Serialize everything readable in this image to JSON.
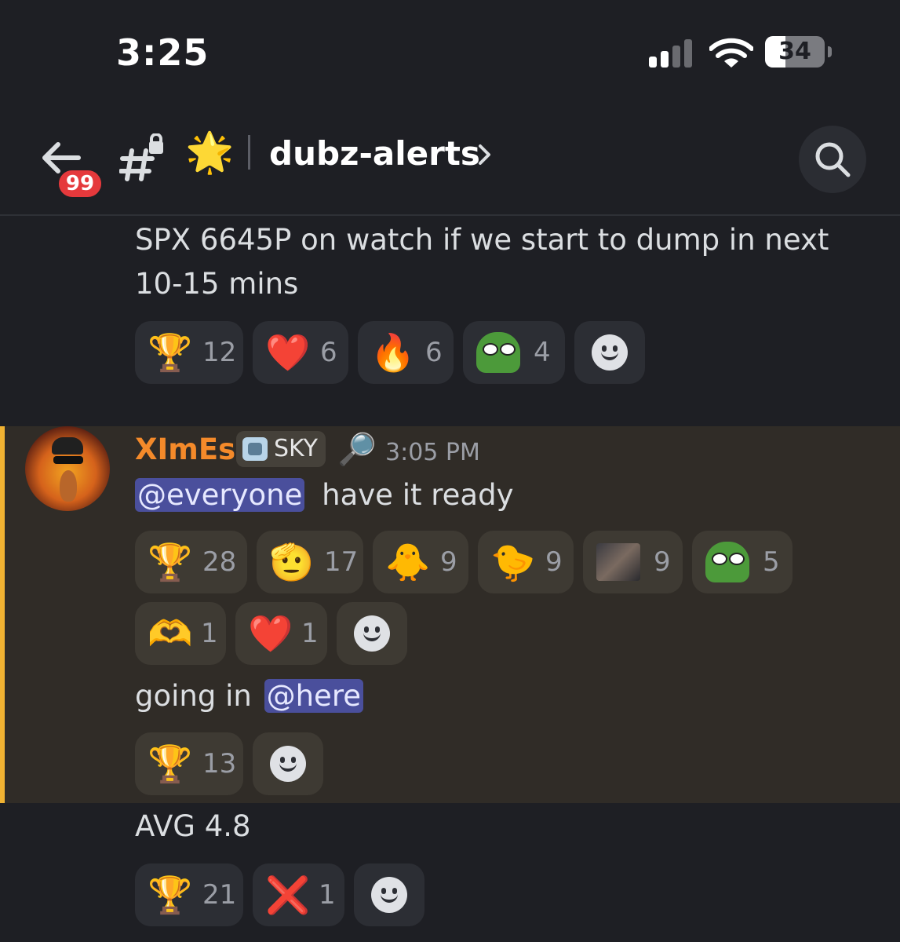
{
  "status_bar": {
    "time": "3:25",
    "battery": "34",
    "battery_level": 0.34
  },
  "header": {
    "notification_count": "99",
    "channel_emoji": "🌟",
    "channel_name": "dubz-alerts"
  },
  "messages": [
    {
      "text": "SPX 6645P on watch if we start to dump in next 10-15 mins",
      "reactions": [
        {
          "emoji": "🏆",
          "count": "12"
        },
        {
          "emoji": "❤️",
          "count": "6"
        },
        {
          "emoji": "🔥",
          "count": "6"
        },
        {
          "emoji": "pepe-sunglasses",
          "count": "4"
        }
      ]
    },
    {
      "author": "XImEs",
      "role": "SKY",
      "role_emoji": "🔎",
      "timestamp": "3:05 PM",
      "mention": "@everyone",
      "text_rest": "have it ready",
      "reactions_row1": [
        {
          "emoji": "🏆",
          "count": "28"
        },
        {
          "emoji": "🫡",
          "count": "17"
        },
        {
          "emoji": "🐥",
          "count": "9"
        },
        {
          "emoji": "🐤",
          "count": "9"
        },
        {
          "emoji": "photo",
          "count": "9"
        },
        {
          "emoji": "pepe-sad",
          "count": "5"
        }
      ],
      "reactions_row2": [
        {
          "emoji": "🫶",
          "count": "1"
        },
        {
          "emoji": "❤️",
          "count": "1"
        }
      ]
    },
    {
      "text_start": "going in",
      "mention": "@here",
      "reactions": [
        {
          "emoji": "🏆",
          "count": "13"
        }
      ]
    },
    {
      "text": "AVG 4.8",
      "reactions": [
        {
          "emoji": "🏆",
          "count": "21"
        },
        {
          "emoji": "❌",
          "count": "1"
        }
      ]
    }
  ]
}
